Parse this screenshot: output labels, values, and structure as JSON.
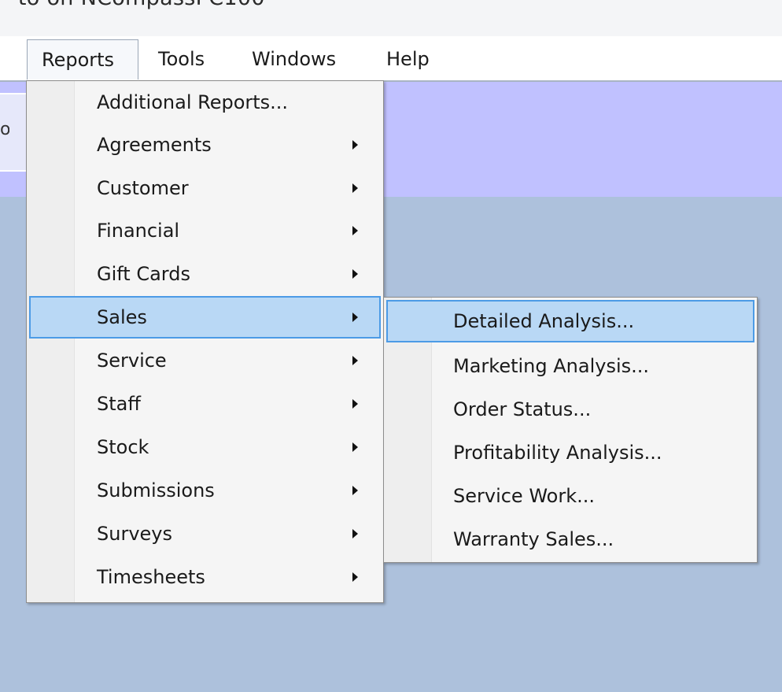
{
  "window": {
    "title": "·to on NCompassPC100"
  },
  "menubar": {
    "items": [
      {
        "label": "Reports",
        "open": true
      },
      {
        "label": "Tools"
      },
      {
        "label": "Windows"
      },
      {
        "label": "Help"
      }
    ]
  },
  "background": {
    "fragment_text": "oc"
  },
  "reports_menu": {
    "items": [
      {
        "label": "Additional Reports...",
        "has_submenu": false
      },
      {
        "label": "Agreements",
        "has_submenu": true
      },
      {
        "label": "Customer",
        "has_submenu": true
      },
      {
        "label": "Financial",
        "has_submenu": true
      },
      {
        "label": "Gift Cards",
        "has_submenu": true
      },
      {
        "label": "Sales",
        "has_submenu": true,
        "selected": true
      },
      {
        "label": "Service",
        "has_submenu": true
      },
      {
        "label": "Staff",
        "has_submenu": true
      },
      {
        "label": "Stock",
        "has_submenu": true
      },
      {
        "label": "Submissions",
        "has_submenu": true
      },
      {
        "label": "Surveys",
        "has_submenu": true
      },
      {
        "label": "Timesheets",
        "has_submenu": true
      }
    ]
  },
  "sales_submenu": {
    "items": [
      {
        "label": "Detailed Analysis...",
        "selected": true
      },
      {
        "label": "Marketing Analysis..."
      },
      {
        "label": "Order Status..."
      },
      {
        "label": "Profitability Analysis..."
      },
      {
        "label": "Service Work..."
      },
      {
        "label": "Warranty Sales..."
      }
    ]
  },
  "colors": {
    "menu_background": "#f5f5f5",
    "selection_fill": "#b9d8f5",
    "selection_border": "#4c9be6",
    "content_header": "#c0c1ff",
    "content_background": "#adc1dc"
  },
  "icons": {
    "submenu_arrow": "submenu-arrow-icon"
  }
}
